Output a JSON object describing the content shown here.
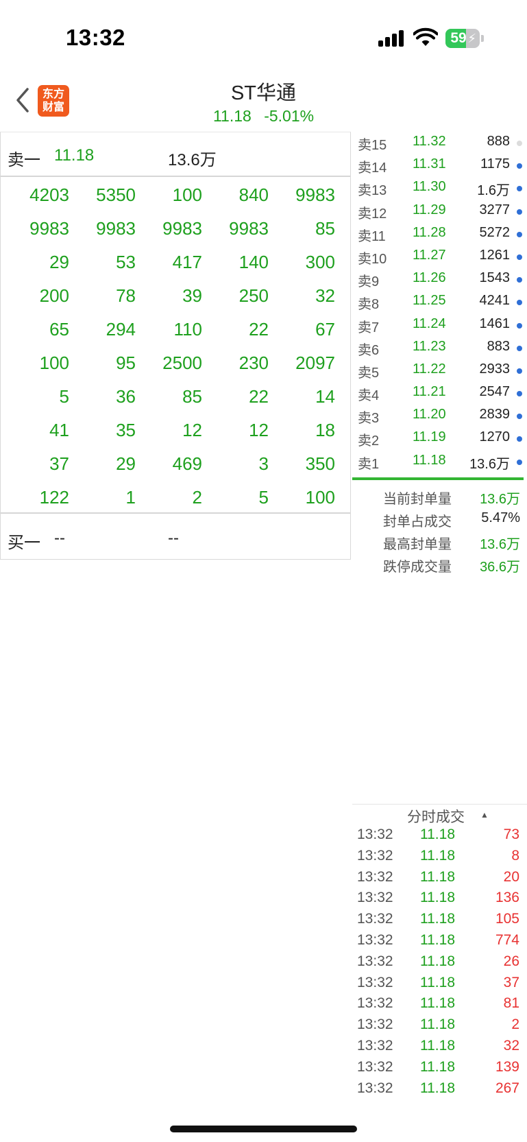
{
  "status_bar": {
    "time": "13:32",
    "battery_percent": "59",
    "battery_level": 0.59,
    "battery_charging": true
  },
  "header": {
    "back_icon": "chevron-left-icon",
    "logo_text_1": "东方",
    "logo_text_2": "财富",
    "stock_name": "ST华通",
    "price": "11.18",
    "change": "-5.01%"
  },
  "order_panel": {
    "sell_one_label": "卖一",
    "sell_one_price": "11.18",
    "sell_one_volume": "13.6万",
    "queue": [
      [
        "4203",
        "5350",
        "100",
        "840",
        "9983"
      ],
      [
        "9983",
        "9983",
        "9983",
        "9983",
        "85"
      ],
      [
        "29",
        "53",
        "417",
        "140",
        "300"
      ],
      [
        "200",
        "78",
        "39",
        "250",
        "32"
      ],
      [
        "65",
        "294",
        "110",
        "22",
        "67"
      ],
      [
        "100",
        "95",
        "2500",
        "230",
        "2097"
      ],
      [
        "5",
        "36",
        "85",
        "22",
        "14"
      ],
      [
        "41",
        "35",
        "12",
        "12",
        "18"
      ],
      [
        "37",
        "29",
        "469",
        "3",
        "350"
      ],
      [
        "122",
        "1",
        "2",
        "5",
        "100"
      ]
    ],
    "buy_one_label": "买一",
    "buy_one_price": "--",
    "buy_one_volume": "--"
  },
  "depth": {
    "levels": [
      {
        "label": "卖15",
        "price": "11.32",
        "volume": "888",
        "dot": "grey"
      },
      {
        "label": "卖14",
        "price": "11.31",
        "volume": "1175",
        "dot": "blue"
      },
      {
        "label": "卖13",
        "price": "11.30",
        "volume": "1.6万",
        "dot": "blue"
      },
      {
        "label": "卖12",
        "price": "11.29",
        "volume": "3277",
        "dot": "blue"
      },
      {
        "label": "卖11",
        "price": "11.28",
        "volume": "5272",
        "dot": "blue"
      },
      {
        "label": "卖10",
        "price": "11.27",
        "volume": "1261",
        "dot": "blue"
      },
      {
        "label": "卖9",
        "price": "11.26",
        "volume": "1543",
        "dot": "blue"
      },
      {
        "label": "卖8",
        "price": "11.25",
        "volume": "4241",
        "dot": "blue"
      },
      {
        "label": "卖7",
        "price": "11.24",
        "volume": "1461",
        "dot": "blue"
      },
      {
        "label": "卖6",
        "price": "11.23",
        "volume": "883",
        "dot": "blue"
      },
      {
        "label": "卖5",
        "price": "11.22",
        "volume": "2933",
        "dot": "blue"
      },
      {
        "label": "卖4",
        "price": "11.21",
        "volume": "2547",
        "dot": "blue"
      },
      {
        "label": "卖3",
        "price": "11.20",
        "volume": "2839",
        "dot": "blue"
      },
      {
        "label": "卖2",
        "price": "11.19",
        "volume": "1270",
        "dot": "blue"
      },
      {
        "label": "卖1",
        "price": "11.18",
        "volume": "13.6万",
        "dot": "blue"
      }
    ]
  },
  "seal_stats": [
    {
      "label": "当前封单量",
      "value": "13.6万",
      "tone": "green"
    },
    {
      "label": "封单占成交",
      "value": "5.47%",
      "tone": "neutral"
    },
    {
      "label": "最高封单量",
      "value": "13.6万",
      "tone": "green"
    },
    {
      "label": "跌停成交量",
      "value": "36.6万",
      "tone": "green"
    }
  ],
  "trades": {
    "title": "分时成交",
    "sort_icon": "sort-up-icon",
    "rows": [
      {
        "time": "13:32",
        "price": "11.18",
        "volume": "73"
      },
      {
        "time": "13:32",
        "price": "11.18",
        "volume": "8"
      },
      {
        "time": "13:32",
        "price": "11.18",
        "volume": "20"
      },
      {
        "time": "13:32",
        "price": "11.18",
        "volume": "136"
      },
      {
        "time": "13:32",
        "price": "11.18",
        "volume": "105"
      },
      {
        "time": "13:32",
        "price": "11.18",
        "volume": "774"
      },
      {
        "time": "13:32",
        "price": "11.18",
        "volume": "26"
      },
      {
        "time": "13:32",
        "price": "11.18",
        "volume": "37"
      },
      {
        "time": "13:32",
        "price": "11.18",
        "volume": "81"
      },
      {
        "time": "13:32",
        "price": "11.18",
        "volume": "2"
      },
      {
        "time": "13:32",
        "price": "11.18",
        "volume": "32"
      },
      {
        "time": "13:32",
        "price": "11.18",
        "volume": "139"
      },
      {
        "time": "13:32",
        "price": "11.18",
        "volume": "267"
      }
    ]
  },
  "colors": {
    "down_green": "#1ea01e",
    "up_red": "#e83232",
    "brand_orange": "#f05a1e",
    "dot_blue": "#2f6fd6"
  }
}
